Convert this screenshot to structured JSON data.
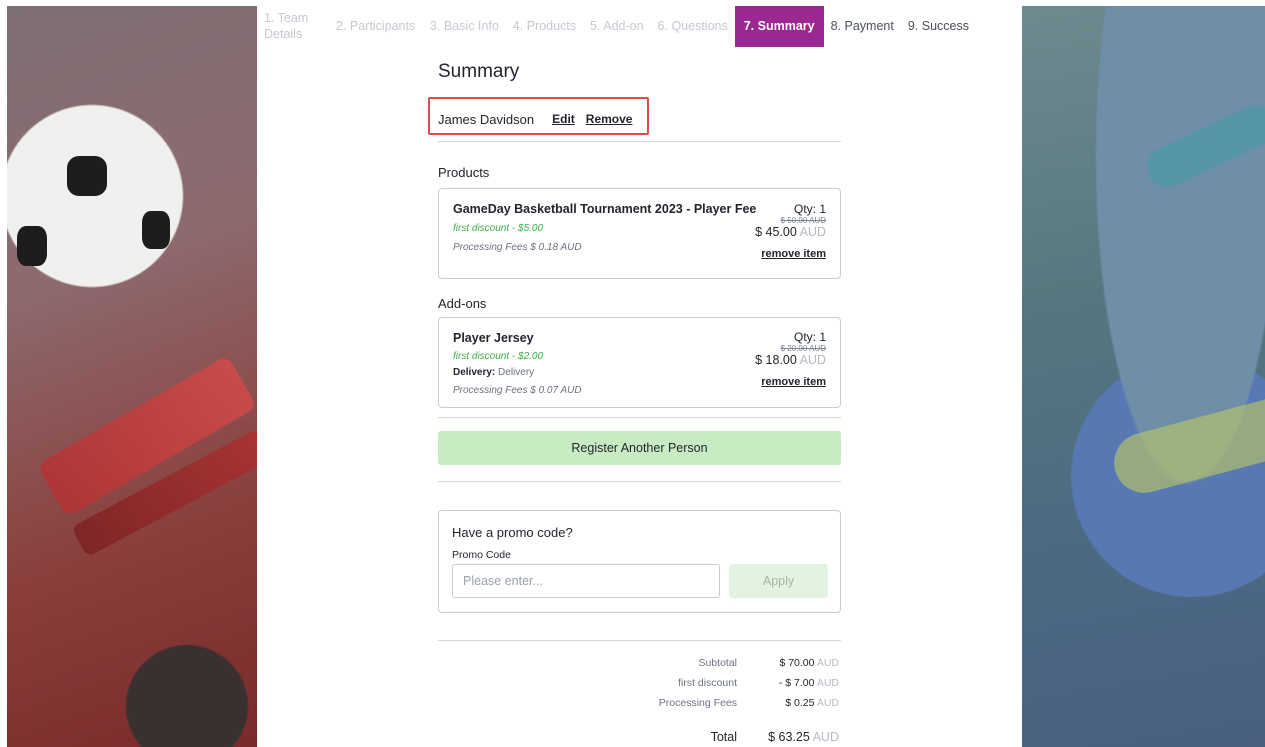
{
  "steps": [
    {
      "label": "1. Team Details",
      "state": "done"
    },
    {
      "label": "2. Participants",
      "state": "done"
    },
    {
      "label": "3. Basic Info",
      "state": "done"
    },
    {
      "label": "4. Products",
      "state": "done"
    },
    {
      "label": "5. Add-on",
      "state": "done"
    },
    {
      "label": "6. Questions",
      "state": "done"
    },
    {
      "label": "7. Summary",
      "state": "active"
    },
    {
      "label": "8. Payment",
      "state": "upcoming"
    },
    {
      "label": "9. Success",
      "state": "upcoming"
    }
  ],
  "summary": {
    "title": "Summary",
    "person": {
      "name": "James Davidson",
      "edit_label": "Edit",
      "remove_label": "Remove"
    },
    "products_label": "Products",
    "products": [
      {
        "name": "GameDay Basketball Tournament 2023 - Player Fee",
        "discount": "first discount - $5.00",
        "processing_fee": "Processing Fees $ 0.18 AUD",
        "qty": "Qty: 1",
        "original_price": "$ 50.00 AUD",
        "price": "$ 45.00",
        "currency": "AUD",
        "remove_label": "remove item"
      }
    ],
    "addons_label": "Add-ons",
    "addons": [
      {
        "name": "Player Jersey",
        "discount": "first discount - $2.00",
        "delivery_label": "Delivery:",
        "delivery_value": "Delivery",
        "processing_fee": "Processing Fees $ 0.07 AUD",
        "qty": "Qty: 1",
        "original_price": "$ 20.00 AUD",
        "price": "$ 18.00",
        "currency": "AUD",
        "remove_label": "remove item"
      }
    ],
    "register_another_label": "Register Another Person"
  },
  "promo": {
    "title": "Have a promo code?",
    "field_label": "Promo Code",
    "placeholder": "Please enter...",
    "apply_label": "Apply"
  },
  "totals": {
    "subtotal_label": "Subtotal",
    "subtotal_value": "$ 70.00",
    "discount_label": "first discount",
    "discount_value": "- $ 7.00",
    "fees_label": "Processing Fees",
    "fees_value": "$ 0.25",
    "total_label": "Total",
    "total_value": "$ 63.25",
    "currency": "AUD"
  },
  "colors": {
    "active_step": "#9a2890",
    "register_button": "#c9ebc4",
    "discount_text": "#3cb043",
    "highlight_box": "#e04c4c"
  }
}
